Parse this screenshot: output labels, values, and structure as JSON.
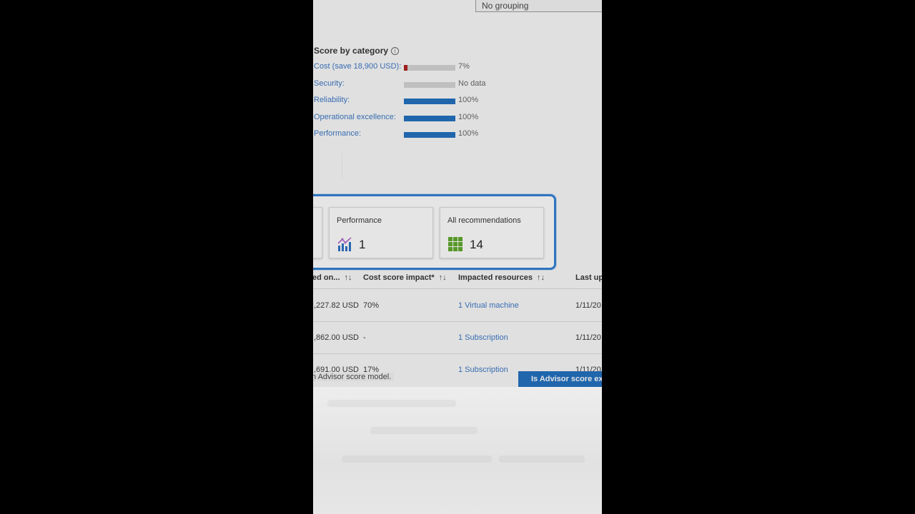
{
  "grouping": {
    "value": "No grouping"
  },
  "score_by_category": {
    "title": "Score by category",
    "items": [
      {
        "label": "Cost (save 18,900 USD):",
        "value_text": "7%",
        "fraction": 0.07,
        "status": "bad"
      },
      {
        "label": "Security:",
        "value_text": "No data",
        "fraction": 0,
        "status": "none"
      },
      {
        "label": "Reliability:",
        "value_text": "100%",
        "fraction": 1.0,
        "status": "good"
      },
      {
        "label": "Operational excellence:",
        "value_text": "100%",
        "fraction": 1.0,
        "status": "good"
      },
      {
        "label": "Performance:",
        "value_text": "100%",
        "fraction": 1.0,
        "status": "good"
      }
    ]
  },
  "tiles": [
    {
      "title": "Performance",
      "count": "1",
      "icon": "performance-chart-icon"
    },
    {
      "title": "All recommendations",
      "count": "14",
      "icon": "grid-icon"
    }
  ],
  "table": {
    "columns": [
      {
        "label": "ed on...",
        "sort_icon": "↑↓"
      },
      {
        "label": "Cost score impact*",
        "sort_icon": "↑↓"
      },
      {
        "label": "Impacted resources",
        "sort_icon": "↑↓"
      },
      {
        "label": "Last up",
        "sort_icon": ""
      }
    ],
    "rows": [
      {
        "savings": ",227.82 USD",
        "impact": "70%",
        "resources": "1 Virtual machine",
        "updated": "1/11/20"
      },
      {
        "savings": ",862.00 USD",
        "impact": "-",
        "resources": "1 Subscription",
        "updated": "1/11/20"
      },
      {
        "savings": ",691.00 USD",
        "impact": "17%",
        "resources": "1 Subscription",
        "updated": "1/11/20"
      }
    ]
  },
  "footer": {
    "text": "n Advisor score model.",
    "button_label": "Is Advisor score ex"
  },
  "colors": {
    "accent": "#1f6fc0",
    "link": "#3a76c4",
    "bad": "#b01c1c",
    "highlight_border": "#2f7fd6"
  }
}
